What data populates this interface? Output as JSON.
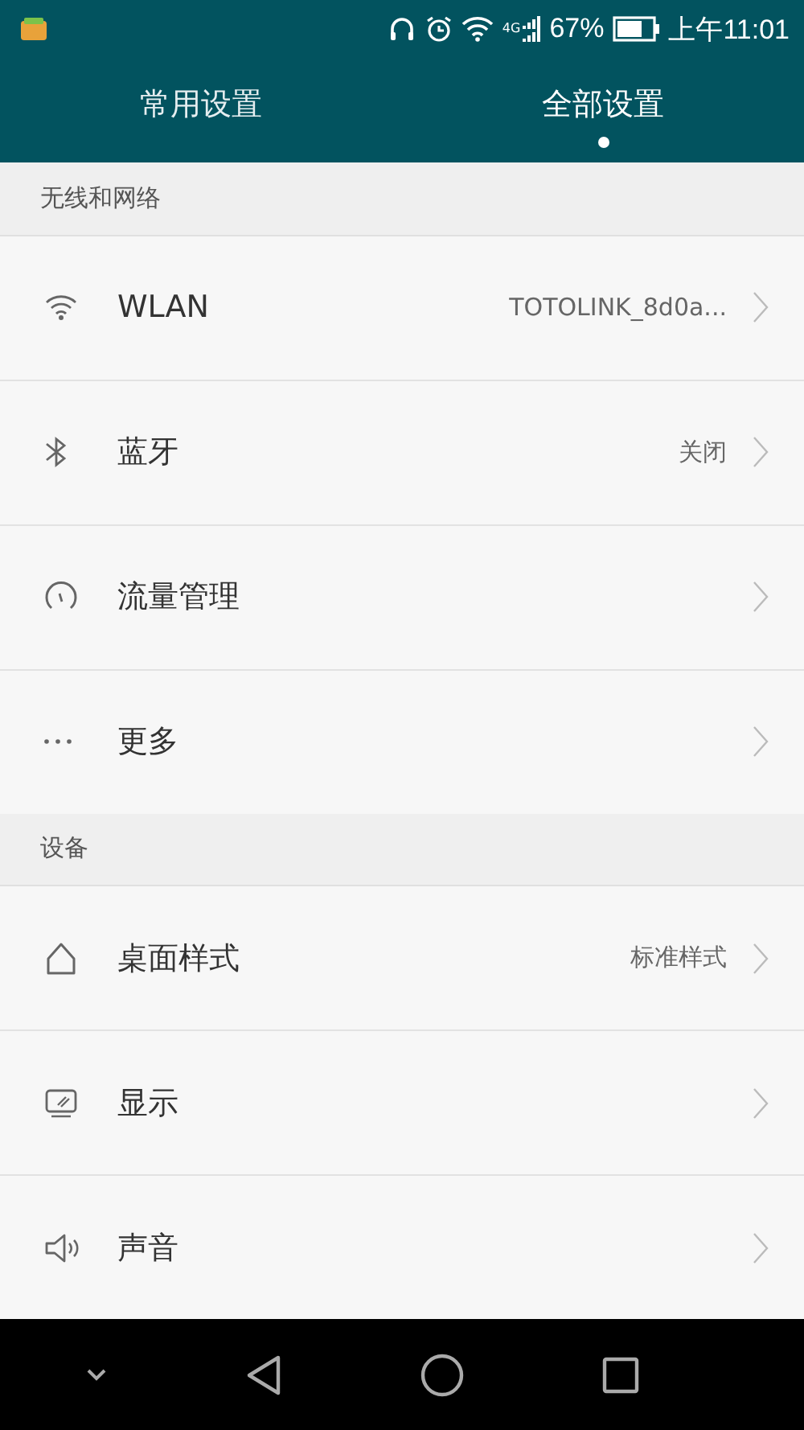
{
  "status_bar": {
    "network": "4G",
    "battery": "67%",
    "time": "上午11:01"
  },
  "tabs": [
    {
      "label": "常用设置",
      "selected": false
    },
    {
      "label": "全部设置",
      "selected": true
    }
  ],
  "sections": [
    {
      "title": "无线和网络",
      "rows": [
        {
          "label": "WLAN",
          "value": "TOTOLINK_8d0a..."
        },
        {
          "label": "蓝牙",
          "value": "关闭"
        },
        {
          "label": "流量管理"
        },
        {
          "label": "更多"
        }
      ]
    },
    {
      "title": "设备",
      "rows": [
        {
          "label": "桌面样式",
          "value": "标准样式"
        },
        {
          "label": "显示"
        },
        {
          "label": "声音"
        }
      ]
    }
  ]
}
